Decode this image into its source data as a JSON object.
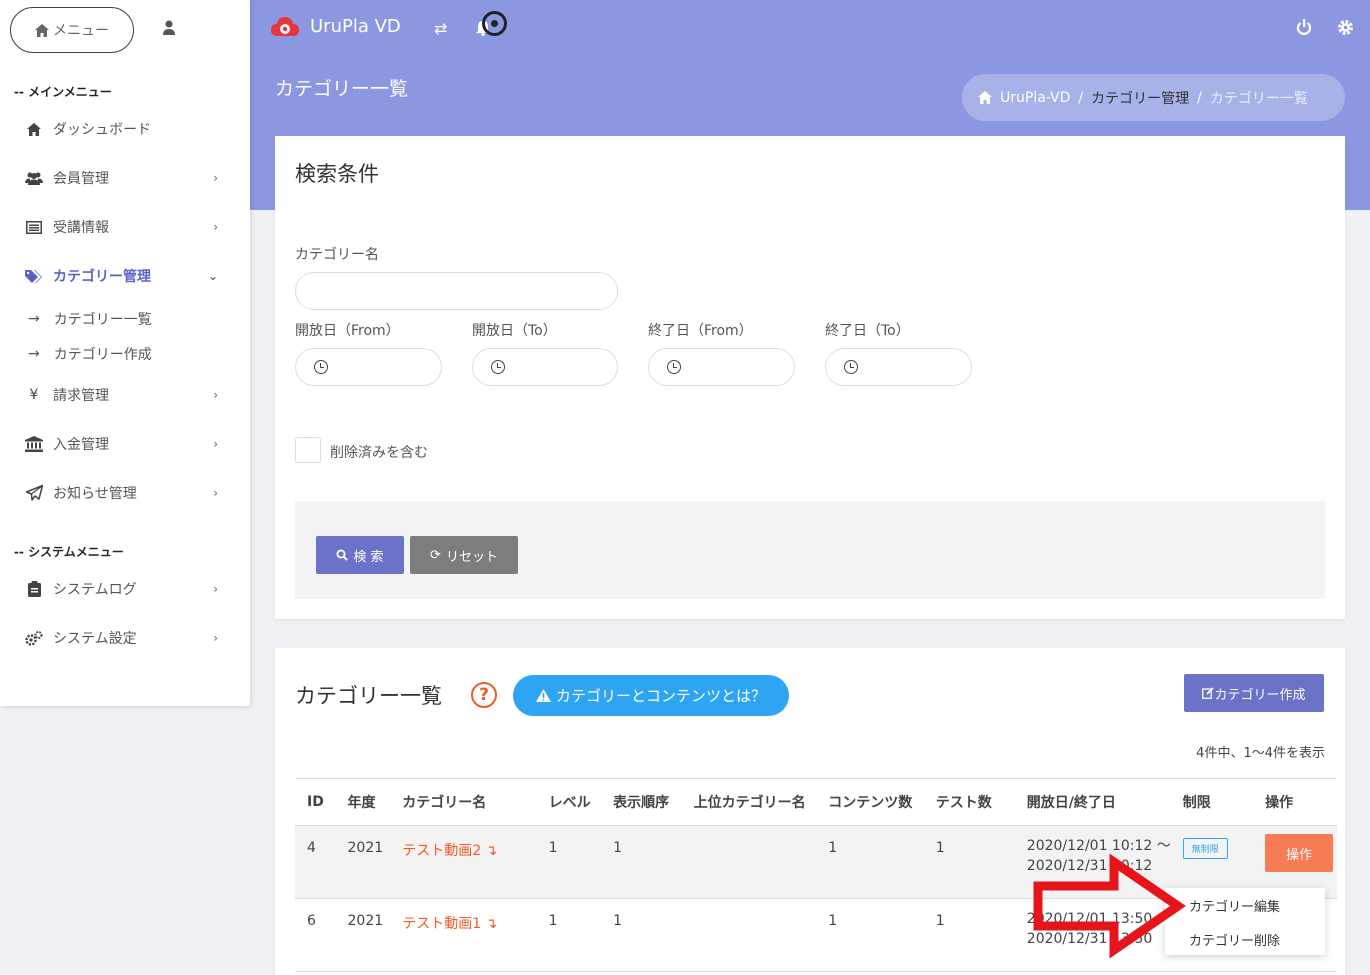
{
  "sidebar": {
    "menu_label": "メニュー",
    "main_section": "-- メインメニュー",
    "system_section": "-- システムメニュー",
    "items": {
      "dashboard": "ダッシュボード",
      "members": "会員管理",
      "courses": "受講情報",
      "category": "カテゴリー管理",
      "billing": "請求管理",
      "payment": "入金管理",
      "news": "お知らせ管理",
      "syslog": "システムログ",
      "sysconfig": "システム設定"
    },
    "sub": {
      "arrow": "→",
      "list": "カテゴリー一覧",
      "create": "カテゴリー作成"
    },
    "yen": "¥"
  },
  "header": {
    "brand": "UruPla VD",
    "page_title": "カテゴリー一覧",
    "breadcrumb": {
      "home": "UruPla-VD",
      "sep": "/",
      "middle": "カテゴリー管理",
      "last": "カテゴリー一覧"
    }
  },
  "search": {
    "title": "検索条件",
    "category_label": "カテゴリー名",
    "open_from": "開放日（From）",
    "open_to": "開放日（To）",
    "end_from": "終了日（From）",
    "end_to": "終了日（To）",
    "include_deleted": "削除済みを含む",
    "search_btn": "検 索",
    "reset_btn": "リセット"
  },
  "list": {
    "title": "カテゴリー一覧",
    "help": "?",
    "info_btn": "カテゴリーとコンテンツとは？",
    "create_btn": "カテゴリー作成",
    "count": "4件中、1〜4件を表示",
    "columns": [
      "ID",
      "年度",
      "カテゴリー名",
      "レベル",
      "表示順序",
      "上位カテゴリー名",
      "コンテンツ数",
      "テスト数",
      "開放日/終了日",
      "制限",
      "操作"
    ],
    "rows": [
      {
        "id": "4",
        "year": "2021",
        "name": "テスト動画2",
        "level": "1",
        "order": "1",
        "parent": "",
        "contents": "1",
        "tests": "1",
        "open": "2020/12/01 10:12 〜",
        "end": "2020/12/31 10:12",
        "limit": "無制限",
        "op": "操作"
      },
      {
        "id": "6",
        "year": "2021",
        "name": "テスト動画1",
        "level": "1",
        "order": "1",
        "parent": "",
        "contents": "1",
        "tests": "1",
        "open": "2020/12/01 13:50 〜",
        "end": "2020/12/31 13:50",
        "limit": "",
        "op": ""
      }
    ]
  },
  "dropdown": {
    "edit": "カテゴリー編集",
    "delete": "カテゴリー削除"
  },
  "colors": {
    "accent": "#8b97e0",
    "primary": "#6b73c8",
    "link": "#f05a28",
    "info": "#2ea5f2",
    "op": "#f77c55",
    "arrow": "#e8141b"
  }
}
